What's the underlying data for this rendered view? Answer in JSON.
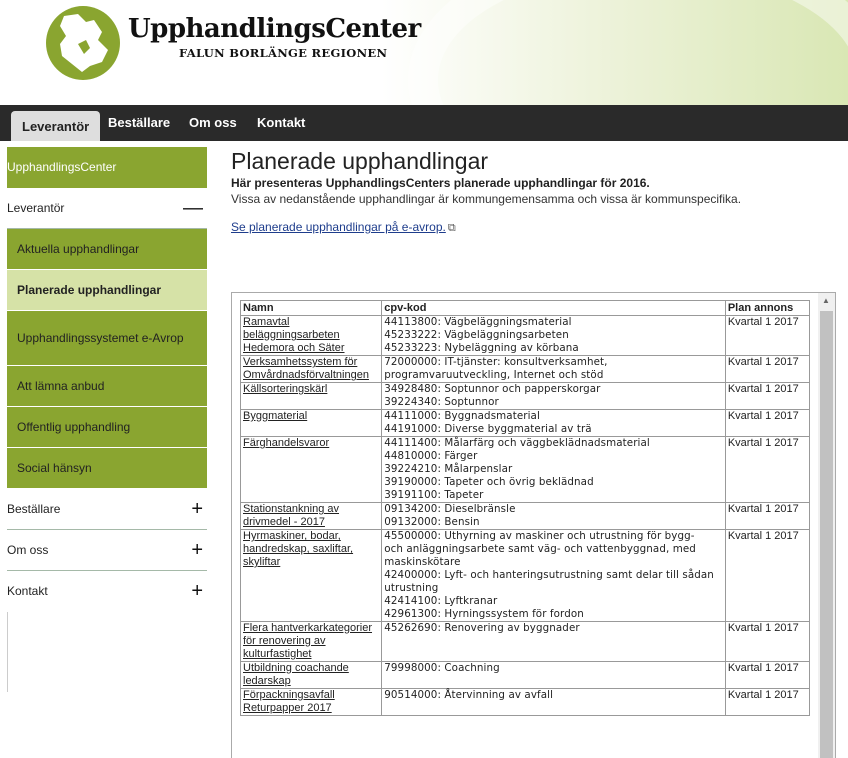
{
  "header": {
    "logo_title": "UpphandlingsCenter",
    "logo_subtitle": "FALUN BORLÄNGE REGIONEN"
  },
  "nav": {
    "tabs": [
      {
        "label": "Leverantör"
      },
      {
        "label": "Beställare"
      },
      {
        "label": "Om oss"
      },
      {
        "label": "Kontakt"
      }
    ]
  },
  "sidebar": {
    "top": "UpphandlingsCenter",
    "section_leverantor": "Leverantör",
    "sub": [
      {
        "label": "Aktuella upphandlingar"
      },
      {
        "label": "Planerade upphandlingar"
      },
      {
        "label": "Upphandlingssystemet e-Avrop"
      },
      {
        "label": "Att lämna anbud"
      },
      {
        "label": "Offentlig upphandling"
      },
      {
        "label": "Social hänsyn"
      }
    ],
    "sections": [
      {
        "label": "Beställare"
      },
      {
        "label": "Om oss"
      },
      {
        "label": "Kontakt"
      }
    ],
    "minus": "—",
    "plus": "+"
  },
  "main": {
    "title": "Planerade upphandlingar",
    "intro_bold": "Här presenteras UpphandlingsCenters planerade upphandlingar för 2016.",
    "intro": "Vissa av nedanstående upphandlingar är kommungemensamma och vissa är kommunspecifika.",
    "link": "Se planerade upphandlingar på e-avrop."
  },
  "table": {
    "headers": [
      "Namn",
      "cpv-kod",
      "Plan annons"
    ],
    "rows": [
      {
        "name": "Ramavtal beläggningsarbeten Hedemora och Säter",
        "cpv": [
          "44113800: Vägbeläggningsmaterial",
          "45233222: Vägbeläggningsarbeten",
          "45233223: Nybeläggning av körbana"
        ],
        "plan": "Kvartal 1 2017"
      },
      {
        "name": "Verksamhetssystem för Omvårdnadsförvaltningen",
        "cpv": [
          "72000000: IT-tjänster: konsultverksamhet,",
          "programvaruutveckling, Internet och stöd"
        ],
        "plan": "Kvartal 1 2017"
      },
      {
        "name": "Källsorteringskärl",
        "cpv": [
          "34928480: Soptunnor och papperskorgar",
          "39224340: Soptunnor"
        ],
        "plan": "Kvartal 1 2017"
      },
      {
        "name": "Byggmaterial",
        "cpv": [
          "44111000: Byggnadsmaterial",
          "44191000: Diverse byggmaterial av trä"
        ],
        "plan": "Kvartal 1 2017"
      },
      {
        "name": "Färghandelsvaror",
        "cpv": [
          "44111400: Målarfärg och väggbeklädnadsmaterial",
          "44810000: Färger",
          "39224210: Målarpenslar",
          "39190000: Tapeter och övrig beklädnad",
          "39191100: Tapeter"
        ],
        "plan": "Kvartal 1 2017"
      },
      {
        "name": "Stationstankning av drivmedel - 2017",
        "cpv": [
          "09134200: Dieselbränsle",
          "09132000: Bensin"
        ],
        "plan": "Kvartal 1 2017"
      },
      {
        "name": "Hyrmaskiner, bodar, handredskap, saxliftar, skyliftar",
        "cpv": [
          "45500000: Uthyrning av maskiner och utrustning för bygg-",
          "och anläggningsarbete samt väg- och vattenbyggnad, med",
          "maskinskötare",
          "42400000: Lyft- och hanteringsutrustning samt delar till sådan",
          "utrustning",
          "42414100: Lyftkranar",
          "42961300: Hyrningssystem för fordon"
        ],
        "plan": "Kvartal 1 2017"
      },
      {
        "name": "Flera hantverkarkategorier för renovering av kulturfastighet",
        "cpv": [
          "45262690: Renovering av byggnader"
        ],
        "plan": "Kvartal 1 2017"
      },
      {
        "name": "Utbildning coachande ledarskap",
        "cpv": [
          "79998000: Coachning"
        ],
        "plan": "Kvartal 1 2017"
      },
      {
        "name": "Förpackningsavfall Returpapper 2017",
        "cpv": [
          "90514000: Återvinning av avfall"
        ],
        "plan": "Kvartal 1 2017"
      }
    ]
  }
}
